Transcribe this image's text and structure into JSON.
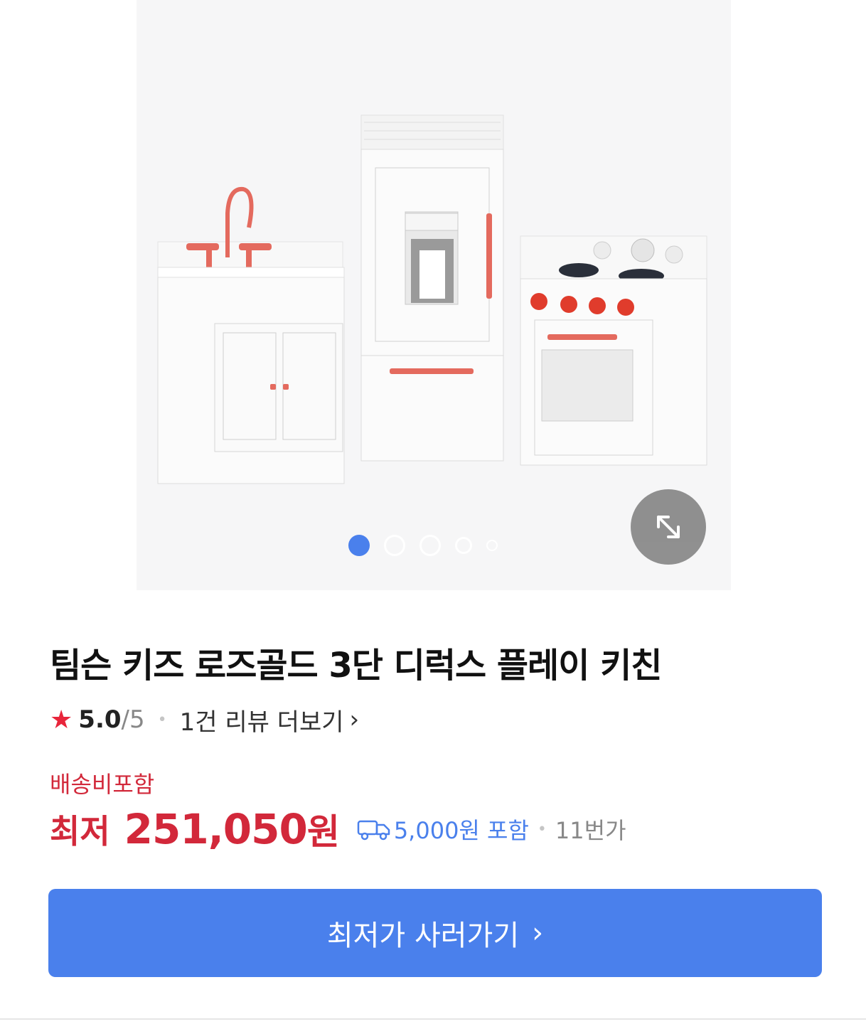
{
  "product": {
    "title": "팀슨 키즈 로즈골드 3단 디럭스 플레이 키친",
    "image_count": 5,
    "active_image": 1
  },
  "rating": {
    "star_icon": "star-icon",
    "score": "5.0",
    "max": "/5",
    "separator": "•",
    "review_link": "1건 리뷰 더보기",
    "chevron": "›"
  },
  "pricing": {
    "shipping_note": "배송비포함",
    "lowest_label": "최저",
    "price": "251,050",
    "price_unit": "원",
    "shipping_fee": "5,000원 포함",
    "separator": "•",
    "seller": "11번가"
  },
  "cta": {
    "label": "최저가 사러가기",
    "chevron": "›"
  },
  "colors": {
    "accent_blue": "#4a80ec",
    "price_red": "#d2283a",
    "star_red": "#e8253b"
  }
}
